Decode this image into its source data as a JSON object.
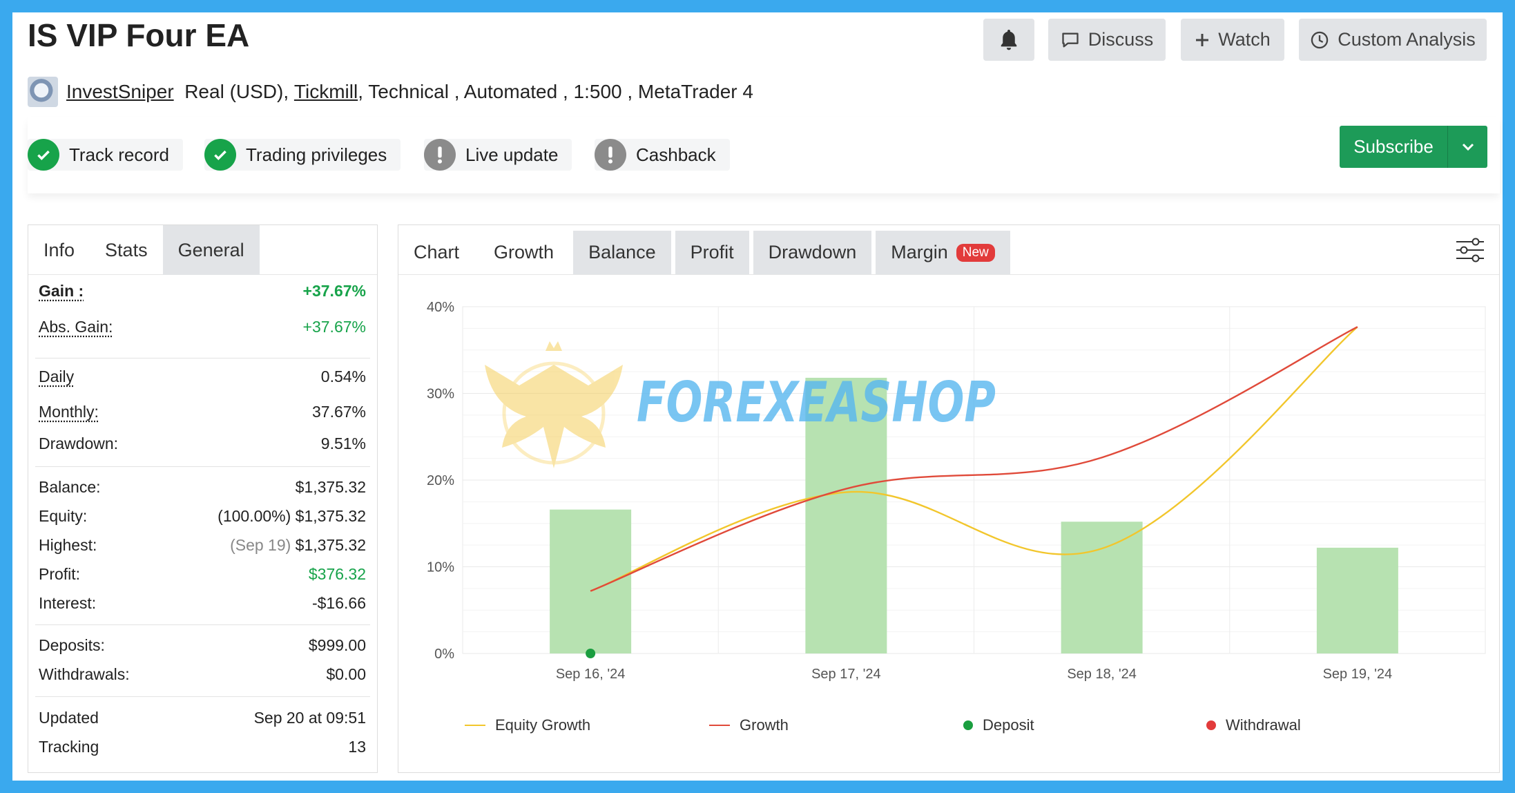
{
  "header": {
    "title": "IS VIP Four EA",
    "buttons": {
      "notify_icon": "bell-icon",
      "discuss_label": "Discuss",
      "watch_label": "Watch",
      "custom_analysis_label": "Custom Analysis"
    }
  },
  "author": {
    "name": "InvestSniper",
    "account": "Real (USD),",
    "broker": "Tickmill",
    "details": ", Technical , Automated , 1:500 , MetaTrader 4"
  },
  "badges": [
    {
      "label": "Track record",
      "status": "ok"
    },
    {
      "label": "Trading privileges",
      "status": "ok"
    },
    {
      "label": "Live update",
      "status": "warning"
    },
    {
      "label": "Cashback",
      "status": "warning"
    }
  ],
  "subscribe": {
    "label": "Subscribe"
  },
  "info_tabs": [
    "Info",
    "Stats",
    "General"
  ],
  "stats": {
    "gain": {
      "label": "Gain :",
      "value": "+37.67%"
    },
    "abs_gain": {
      "label": "Abs. Gain:",
      "value": "+37.67%"
    },
    "daily": {
      "label": "Daily",
      "value": "0.54%"
    },
    "monthly": {
      "label": "Monthly:",
      "value": "37.67%"
    },
    "drawdown": {
      "label": "Drawdown:",
      "value": "9.51%"
    },
    "balance": {
      "label": "Balance:",
      "value": "$1,375.32"
    },
    "equity": {
      "label": "Equity:",
      "pct": "(100.00%)",
      "value": "$1,375.32"
    },
    "highest": {
      "label": "Highest:",
      "date": "(Sep 19)",
      "value": "$1,375.32"
    },
    "profit": {
      "label": "Profit:",
      "value": "$376.32"
    },
    "interest": {
      "label": "Interest:",
      "value": "-$16.66"
    },
    "deposits": {
      "label": "Deposits:",
      "value": "$999.00"
    },
    "withdrawals": {
      "label": "Withdrawals:",
      "value": "$0.00"
    },
    "updated": {
      "label": "Updated",
      "value": "Sep 20 at 09:51"
    },
    "tracking": {
      "label": "Tracking",
      "value": "13"
    }
  },
  "chart_tabs": {
    "chart": "Chart",
    "growth": "Growth",
    "balance": "Balance",
    "profit": "Profit",
    "drawdown": "Drawdown",
    "margin": "Margin",
    "new_badge": "New"
  },
  "watermark": {
    "text": "FOREXEASHOP"
  },
  "colors": {
    "equity_growth": "#f2c62c",
    "growth": "#e04a3a",
    "deposit": "#1a9e3f",
    "withdrawal": "#e23b3b",
    "bars": "#b7e2b1",
    "subscribe": "#1d9b58"
  },
  "chart_data": {
    "type": "bar",
    "categories": [
      "Sep 16, '24",
      "Sep 17, '24",
      "Sep 18, '24",
      "Sep 19, '24"
    ],
    "ylim": [
      0,
      40
    ],
    "yticks": [
      "0%",
      "10%",
      "20%",
      "30%",
      "40%"
    ],
    "bars": [
      16.6,
      31.8,
      15.2,
      12.2
    ],
    "series": [
      {
        "name": "Equity Growth",
        "type": "line",
        "values": [
          7.2,
          18.6,
          12.1,
          37.67
        ]
      },
      {
        "name": "Growth",
        "type": "line",
        "values": [
          7.2,
          19.0,
          22.6,
          37.67
        ]
      }
    ],
    "deposit_points": [
      {
        "x": "Sep 16, '24",
        "y": 0
      }
    ],
    "legend": [
      "Equity Growth",
      "Growth",
      "Deposit",
      "Withdrawal"
    ],
    "grid": true
  }
}
